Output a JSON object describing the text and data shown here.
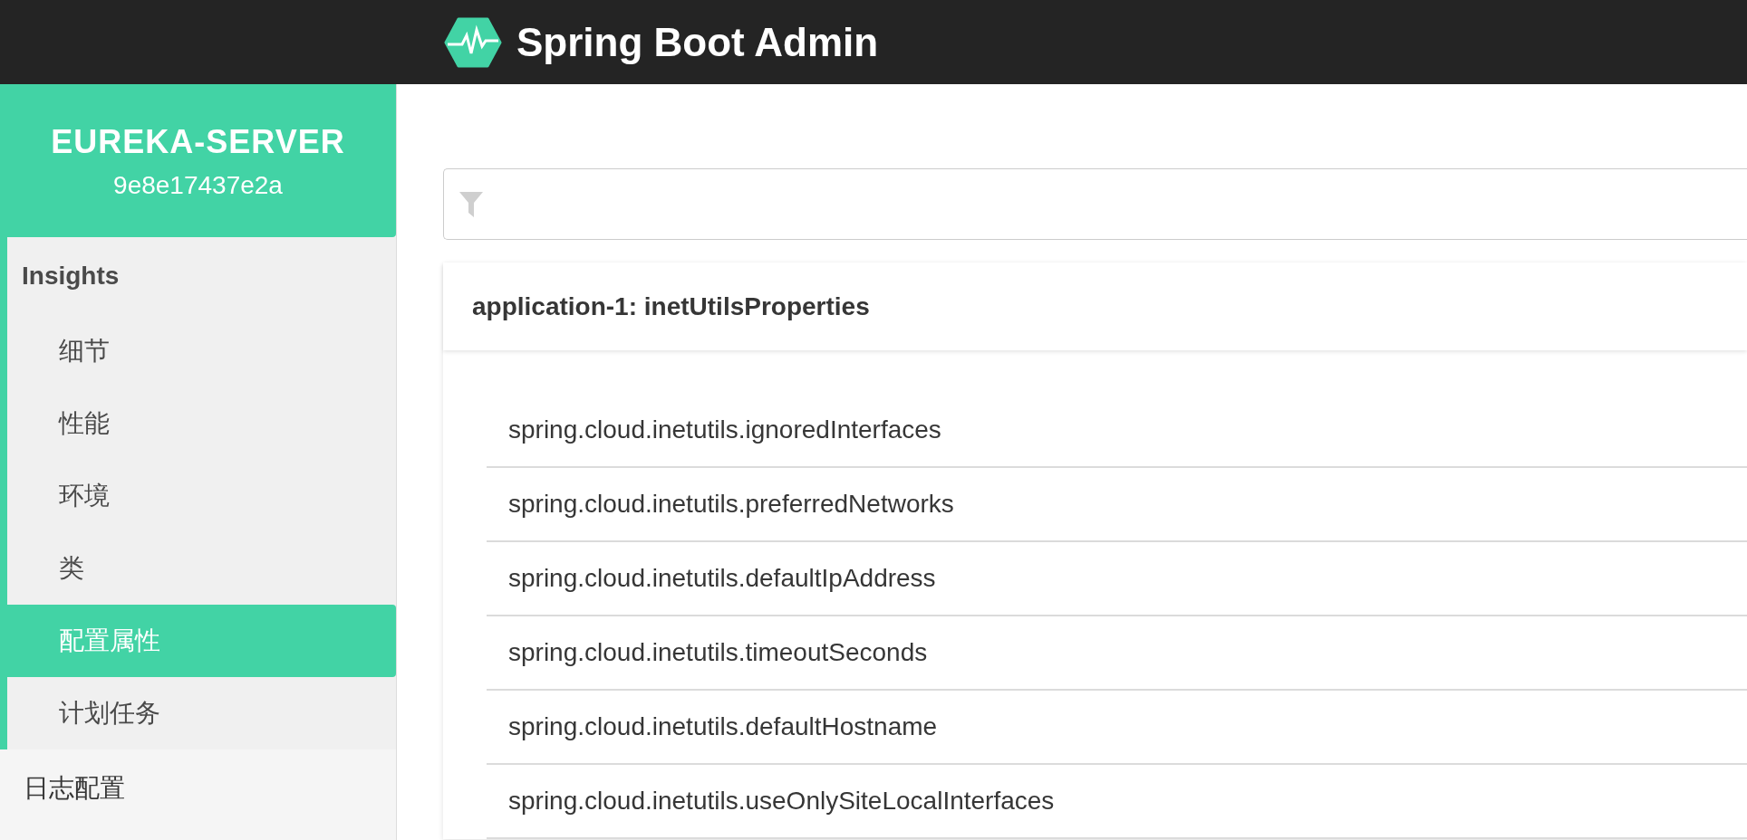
{
  "header": {
    "title": "Spring Boot Admin"
  },
  "sidebar": {
    "app_name": "EUREKA-SERVER",
    "instance_id": "9e8e17437e2a",
    "groups": [
      {
        "label": "Insights",
        "children": [
          {
            "label": "细节",
            "selected": false
          },
          {
            "label": "性能",
            "selected": false
          },
          {
            "label": "环境",
            "selected": false
          },
          {
            "label": "类",
            "selected": false
          },
          {
            "label": "配置属性",
            "selected": true
          },
          {
            "label": "计划任务",
            "selected": false
          }
        ]
      },
      {
        "label": "日志配置"
      }
    ]
  },
  "card": {
    "title": "application-1: inetUtilsProperties",
    "properties": [
      "spring.cloud.inetutils.ignoredInterfaces",
      "spring.cloud.inetutils.preferredNetworks",
      "spring.cloud.inetutils.defaultIpAddress",
      "spring.cloud.inetutils.timeoutSeconds",
      "spring.cloud.inetutils.defaultHostname",
      "spring.cloud.inetutils.useOnlySiteLocalInterfaces"
    ]
  }
}
